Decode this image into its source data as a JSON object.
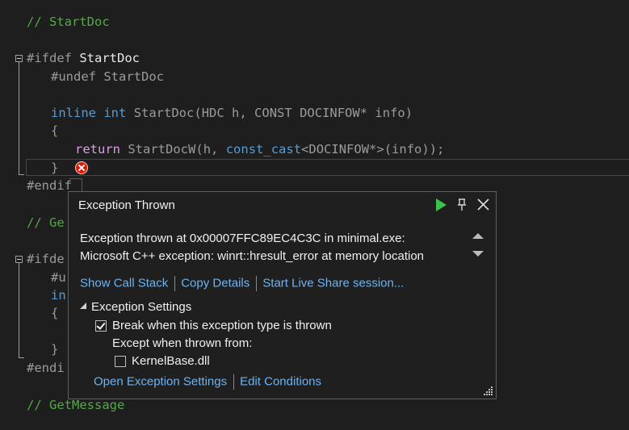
{
  "code": {
    "l1_comment": "// StartDoc",
    "l2_kw": "#ifdef",
    "l2_name": "StartDoc",
    "l3_kw": "#undef",
    "l3_name": "StartDoc",
    "l5_inline": "inline",
    "l5_int": "int",
    "l5_fn": "StartDoc",
    "l5_open": "(",
    "l5_type1": "HDC",
    "l5_p1": "h",
    "l5_comma": ", ",
    "l5_macro": "CONST",
    "l5_type2": "DOCINFOW",
    "l5_star": "*",
    "l5_p2": "info",
    "l5_close": ")",
    "l6": "{",
    "l7_return": "return",
    "l7_fn": "StartDocW",
    "l7_open": "(",
    "l7_p1": "h",
    "l7_comma": ", ",
    "l7_cast": "const_cast",
    "l7_lt": "<",
    "l7_type": "DOCINFOW",
    "l7_rest": "*>(",
    "l7_p2": "info",
    "l7_end": "));",
    "l8": "}",
    "l9": "#endif",
    "l11_comment": "// Ge",
    "l13": "#ifde",
    "l14": "#u",
    "l15": "in",
    "l16": "{",
    "l18": "}",
    "l19": "#endi",
    "l21_comment": "// GetMessage"
  },
  "popup": {
    "title": "Exception Thrown",
    "message_line1": "Exception thrown at 0x00007FFC89EC4C3C in minimal.exe:",
    "message_line2": "Microsoft C++ exception: winrt::hresult_error at memory location",
    "link_call_stack": "Show Call Stack",
    "link_copy_details": "Copy Details",
    "link_live_share": "Start Live Share session...",
    "settings_header": "Exception Settings",
    "break_label": "Break when this exception type is thrown",
    "break_checked": true,
    "except_label": "Except when thrown from:",
    "kernelbase_label": "KernelBase.dll",
    "kernelbase_checked": false,
    "link_open_settings": "Open Exception Settings",
    "link_edit_conditions": "Edit Conditions"
  },
  "colors": {
    "background": "#1e1e1e",
    "comment": "#57a64a",
    "keyword": "#569cd6",
    "link": "#6fb3ef",
    "continue_green": "#3cc34c",
    "error_red": "#e51400"
  }
}
